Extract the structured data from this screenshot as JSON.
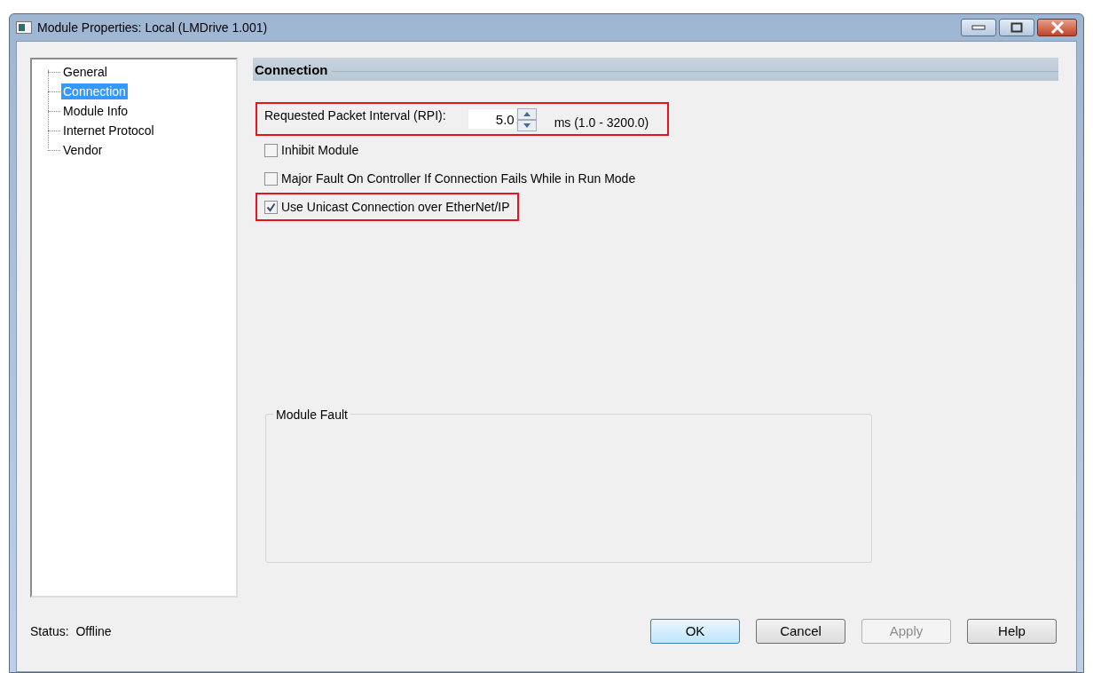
{
  "window": {
    "title": "Module Properties: Local (LMDrive 1.001)"
  },
  "tree": [
    {
      "label": "General",
      "selected": false
    },
    {
      "label": "Connection",
      "selected": true
    },
    {
      "label": "Module Info",
      "selected": false
    },
    {
      "label": "Internet Protocol",
      "selected": false
    },
    {
      "label": "Vendor",
      "selected": false
    }
  ],
  "section": {
    "title": "Connection"
  },
  "rpi": {
    "label": "Requested Packet Interval (RPI):",
    "value": "5.0",
    "range": "ms (1.0 - 3200.0)",
    "highlighted": true
  },
  "options": [
    {
      "label": "Inhibit Module",
      "checked": false,
      "highlighted": false
    },
    {
      "label": "Major Fault On Controller If Connection Fails While in Run Mode",
      "checked": false,
      "highlighted": false
    },
    {
      "label": "Use Unicast Connection over EtherNet/IP",
      "checked": true,
      "highlighted": true
    }
  ],
  "fault_group": {
    "title": "Module Fault"
  },
  "status": {
    "label": "Status:",
    "value": "Offline"
  },
  "buttons": [
    {
      "label": "OK",
      "kind": "default",
      "disabled": false
    },
    {
      "label": "Cancel",
      "kind": "normal",
      "disabled": false
    },
    {
      "label": "Apply",
      "kind": "normal",
      "disabled": true
    },
    {
      "label": "Help",
      "kind": "normal",
      "disabled": false
    }
  ]
}
